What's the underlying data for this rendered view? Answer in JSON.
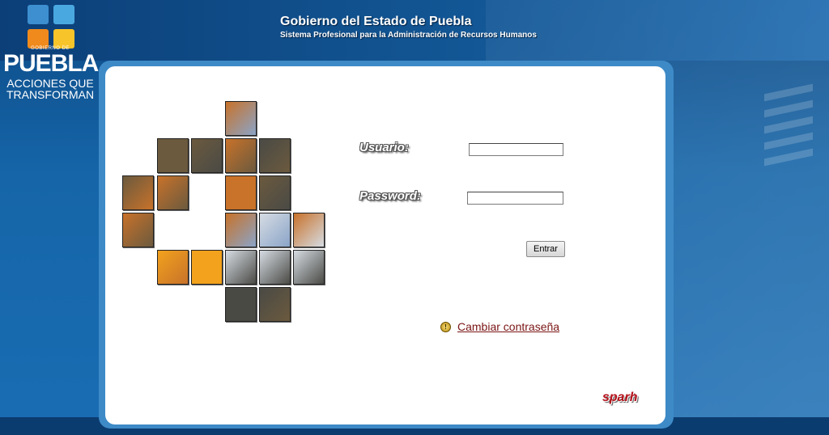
{
  "logo": {
    "small_text": "GOBIERNO DE",
    "big_text": "PUEBLA",
    "slogan_line1": "ACCIONES QUE",
    "slogan_line2": "TRANSFORMAN",
    "tile_colors": [
      "#3d8fd0",
      "#4aa8e0",
      "#f08a1c",
      "#f7c42a"
    ]
  },
  "header": {
    "title": "Gobierno del Estado de Puebla",
    "subtitle": "Sistema Profesional para la Administración de Recursos Humanos"
  },
  "login": {
    "usuario_label": "Usuario:",
    "usuario_value": "",
    "password_label": "Password:",
    "password_value": "",
    "submit_label": "Entrar",
    "change_password_icon": "info-coin-icon",
    "change_password_link": "Cambiar contraseña"
  },
  "brand": "sparh",
  "mosaic_colors": {
    "orange": "#c8722a",
    "sky": "#8aa4c8",
    "earth": "#6b5a3e",
    "sun": "#f2a21d",
    "snow": "#d6dce3",
    "rock": "#4a4a45"
  }
}
